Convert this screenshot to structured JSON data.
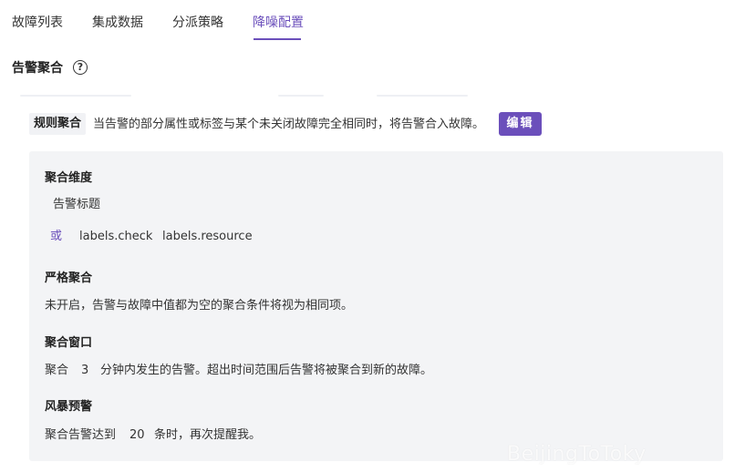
{
  "tabs": [
    {
      "label": "故障列表",
      "active": false
    },
    {
      "label": "集成数据",
      "active": false
    },
    {
      "label": "分派策略",
      "active": false
    },
    {
      "label": "降噪配置",
      "active": true
    }
  ],
  "section": {
    "title": "告警聚合",
    "help_icon": "question-circle-icon"
  },
  "rule": {
    "tag": "规则聚合",
    "description": "当告警的部分属性或标签与某个未关闭故障完全相同时，将告警合入故障。",
    "edit_label": "编辑"
  },
  "panel": {
    "dimension": {
      "label": "聚合维度",
      "first": "告警标题",
      "or_label": "或",
      "alternatives": [
        "labels.check",
        "labels.resource"
      ]
    },
    "strict": {
      "label": "严格聚合",
      "text": "未开启，告警与故障中值都为空的聚合条件将视为相同项。"
    },
    "window": {
      "label": "聚合窗口",
      "prefix": "聚合",
      "value": "3",
      "suffix": "分钟内发生的告警。超出时间范围后告警将被聚合到新的故障。"
    },
    "storm": {
      "label": "风暴预警",
      "prefix": "聚合告警达到",
      "value": "20",
      "suffix": "条时，再次提醒我。"
    }
  },
  "watermark": "BeijingToToky",
  "colors": {
    "accent": "#6b4fbb",
    "panel_bg": "#f3f4f6"
  }
}
